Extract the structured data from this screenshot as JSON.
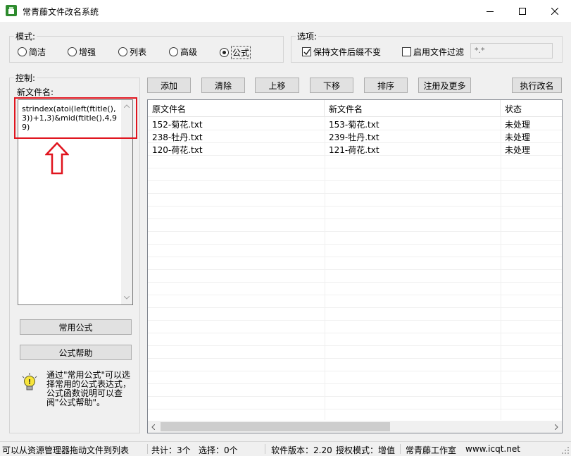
{
  "window": {
    "title": "常青藤文件改名系统",
    "icon": "app-icon",
    "controls": [
      "minimize-icon",
      "maximize-icon",
      "close-icon"
    ]
  },
  "mode": {
    "label": "模式:",
    "options": [
      "简洁",
      "增强",
      "列表",
      "高级",
      "公式"
    ],
    "selected": "公式"
  },
  "options": {
    "label": "选项:",
    "keep_ext": {
      "label": "保持文件后缀不变",
      "checked": true
    },
    "enable_filter": {
      "label": "启用文件过滤",
      "checked": false
    },
    "filter_value": "*.*"
  },
  "control": {
    "label": "控制:",
    "new_name_label": "新文件名:",
    "formula": "strindex(atoi(left(ftitle(),3))+1,3)&mid(ftitle(),4,99)",
    "common_formula_button": "常用公式",
    "formula_help_button": "公式帮助",
    "hint_icon": "lightbulb-icon",
    "hint": "通过\"常用公式\"可以选择常用的公式表达式，公式函数说明可以查阅\"公式帮助\"。"
  },
  "toolbar": {
    "add": "添加",
    "clear": "清除",
    "up": "上移",
    "down": "下移",
    "sort": "排序",
    "register": "注册及更多",
    "execute": "执行改名"
  },
  "table": {
    "columns": [
      "原文件名",
      "新文件名",
      "状态"
    ],
    "rows": [
      [
        "152-菊花.txt",
        "153-菊花.txt",
        "未处理"
      ],
      [
        "238-牡丹.txt",
        "239-牡丹.txt",
        "未处理"
      ],
      [
        "120-荷花.txt",
        "121-荷花.txt",
        "未处理"
      ]
    ]
  },
  "statusbar": {
    "hint": "可以从资源管理器拖动文件到列表",
    "total": "共计：3个",
    "selected": "选择：0个",
    "version": "软件版本：2.20",
    "license": "授权模式：增值",
    "studio": "常青藤工作室",
    "website": "www.icqt.net"
  },
  "annotation": {
    "color": "#e0141e",
    "arrow_icon": "up-arrow-icon"
  }
}
